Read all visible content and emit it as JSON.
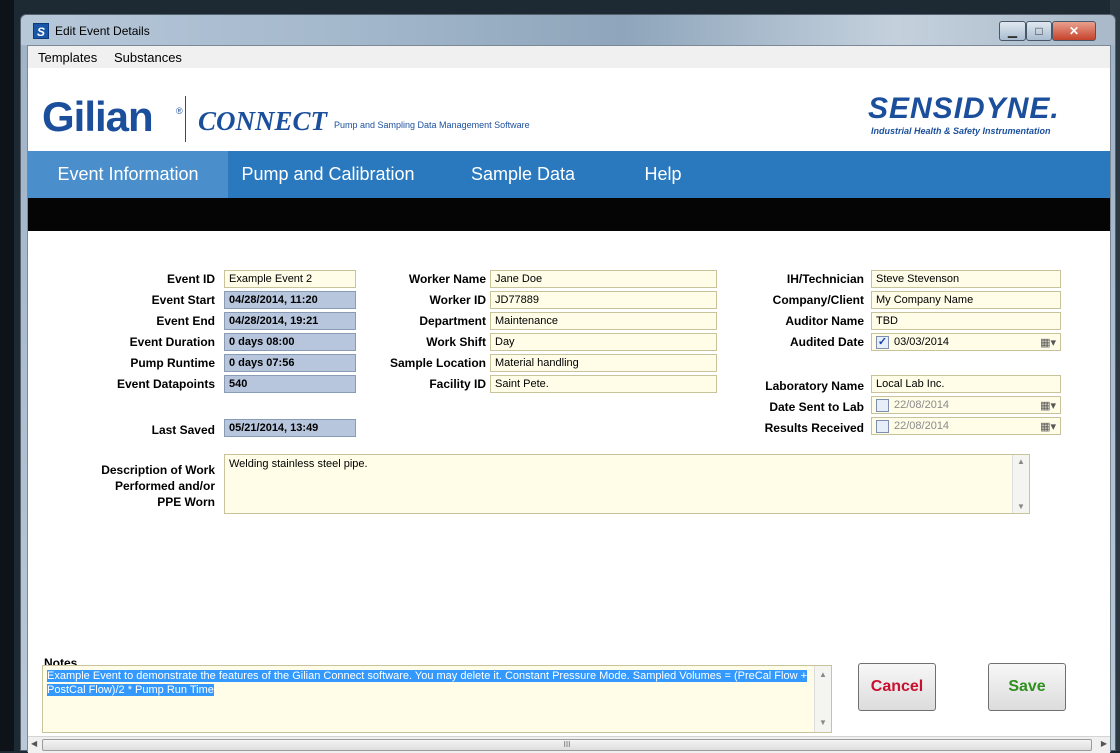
{
  "window": {
    "title": "Edit Event Details",
    "app_icon": "S",
    "min_icon": "minimize-icon",
    "max_icon": "maximize-icon",
    "close_icon": "close-icon"
  },
  "menu": {
    "items": [
      "Templates",
      "Substances"
    ]
  },
  "branding": {
    "gilian": "Gilian",
    "reg": "®",
    "connect": "CONNECT",
    "connect_sub": "Pump and Sampling Data Management Software",
    "sensidyne": "SENSIDYNE.",
    "sensidyne_sub": "Industrial Health & Safety Instrumentation",
    "brand_color": "#1b4f9c"
  },
  "nav": {
    "tabs": [
      "Event Information",
      "Pump and Calibration",
      "Sample Data",
      "Help"
    ],
    "active": "Event Information",
    "bar_color": "#2a79bf"
  },
  "event": {
    "event_id_label": "Event ID",
    "event_id": "Example Event 2",
    "event_start_label": "Event Start",
    "event_start": "04/28/2014, 11:20",
    "event_end_label": "Event End",
    "event_end": "04/28/2014, 19:21",
    "event_duration_label": "Event Duration",
    "event_duration": "0 days  08:00",
    "pump_runtime_label": "Pump Runtime",
    "pump_runtime": "0 days  07:56",
    "event_datapoints_label": "Event Datapoints",
    "event_datapoints": "540",
    "last_saved_label": "Last Saved",
    "last_saved": "05/21/2014, 13:49"
  },
  "worker": {
    "worker_name_label": "Worker Name",
    "worker_name": "Jane Doe",
    "worker_id_label": "Worker ID",
    "worker_id": "JD77889",
    "department_label": "Department",
    "department": "Maintenance",
    "work_shift_label": "Work Shift",
    "work_shift": "Day",
    "sample_location_label": "Sample Location",
    "sample_location": "Material handling",
    "facility_id_label": "Facility ID",
    "facility_id": "Saint Pete."
  },
  "audit": {
    "ih_technician_label": "IH/Technician",
    "ih_technician": "Steve Stevenson",
    "company_client_label": "Company/Client",
    "company_client": "My Company Name",
    "auditor_name_label": "Auditor Name",
    "auditor_name": "TBD",
    "audited_date_label": "Audited Date",
    "audited_date": "03/03/2014",
    "audited_checked": "✓",
    "laboratory_name_label": "Laboratory Name",
    "laboratory_name": "Local Lab Inc.",
    "date_sent_label": "Date Sent to Lab",
    "date_sent": "22/08/2014",
    "results_received_label": "Results Received",
    "results_received": "22/08/2014"
  },
  "description": {
    "label_line1": "Description of Work",
    "label_line2": "Performed and/or",
    "label_line3": "PPE Worn",
    "value": "Welding stainless steel pipe."
  },
  "notes": {
    "label": "Notes",
    "value": "Example Event to demonstrate the features of the Gilian Connect software.  You may delete it.    Constant Pressure Mode.  Sampled Volumes = (PreCal Flow + PostCal Flow)/2 * Pump Run Time"
  },
  "buttons": {
    "cancel": "Cancel",
    "save": "Save",
    "cancel_color": "#c8102e",
    "save_color": "#2f8f1f"
  },
  "scrollbar": {
    "grip": "III"
  }
}
